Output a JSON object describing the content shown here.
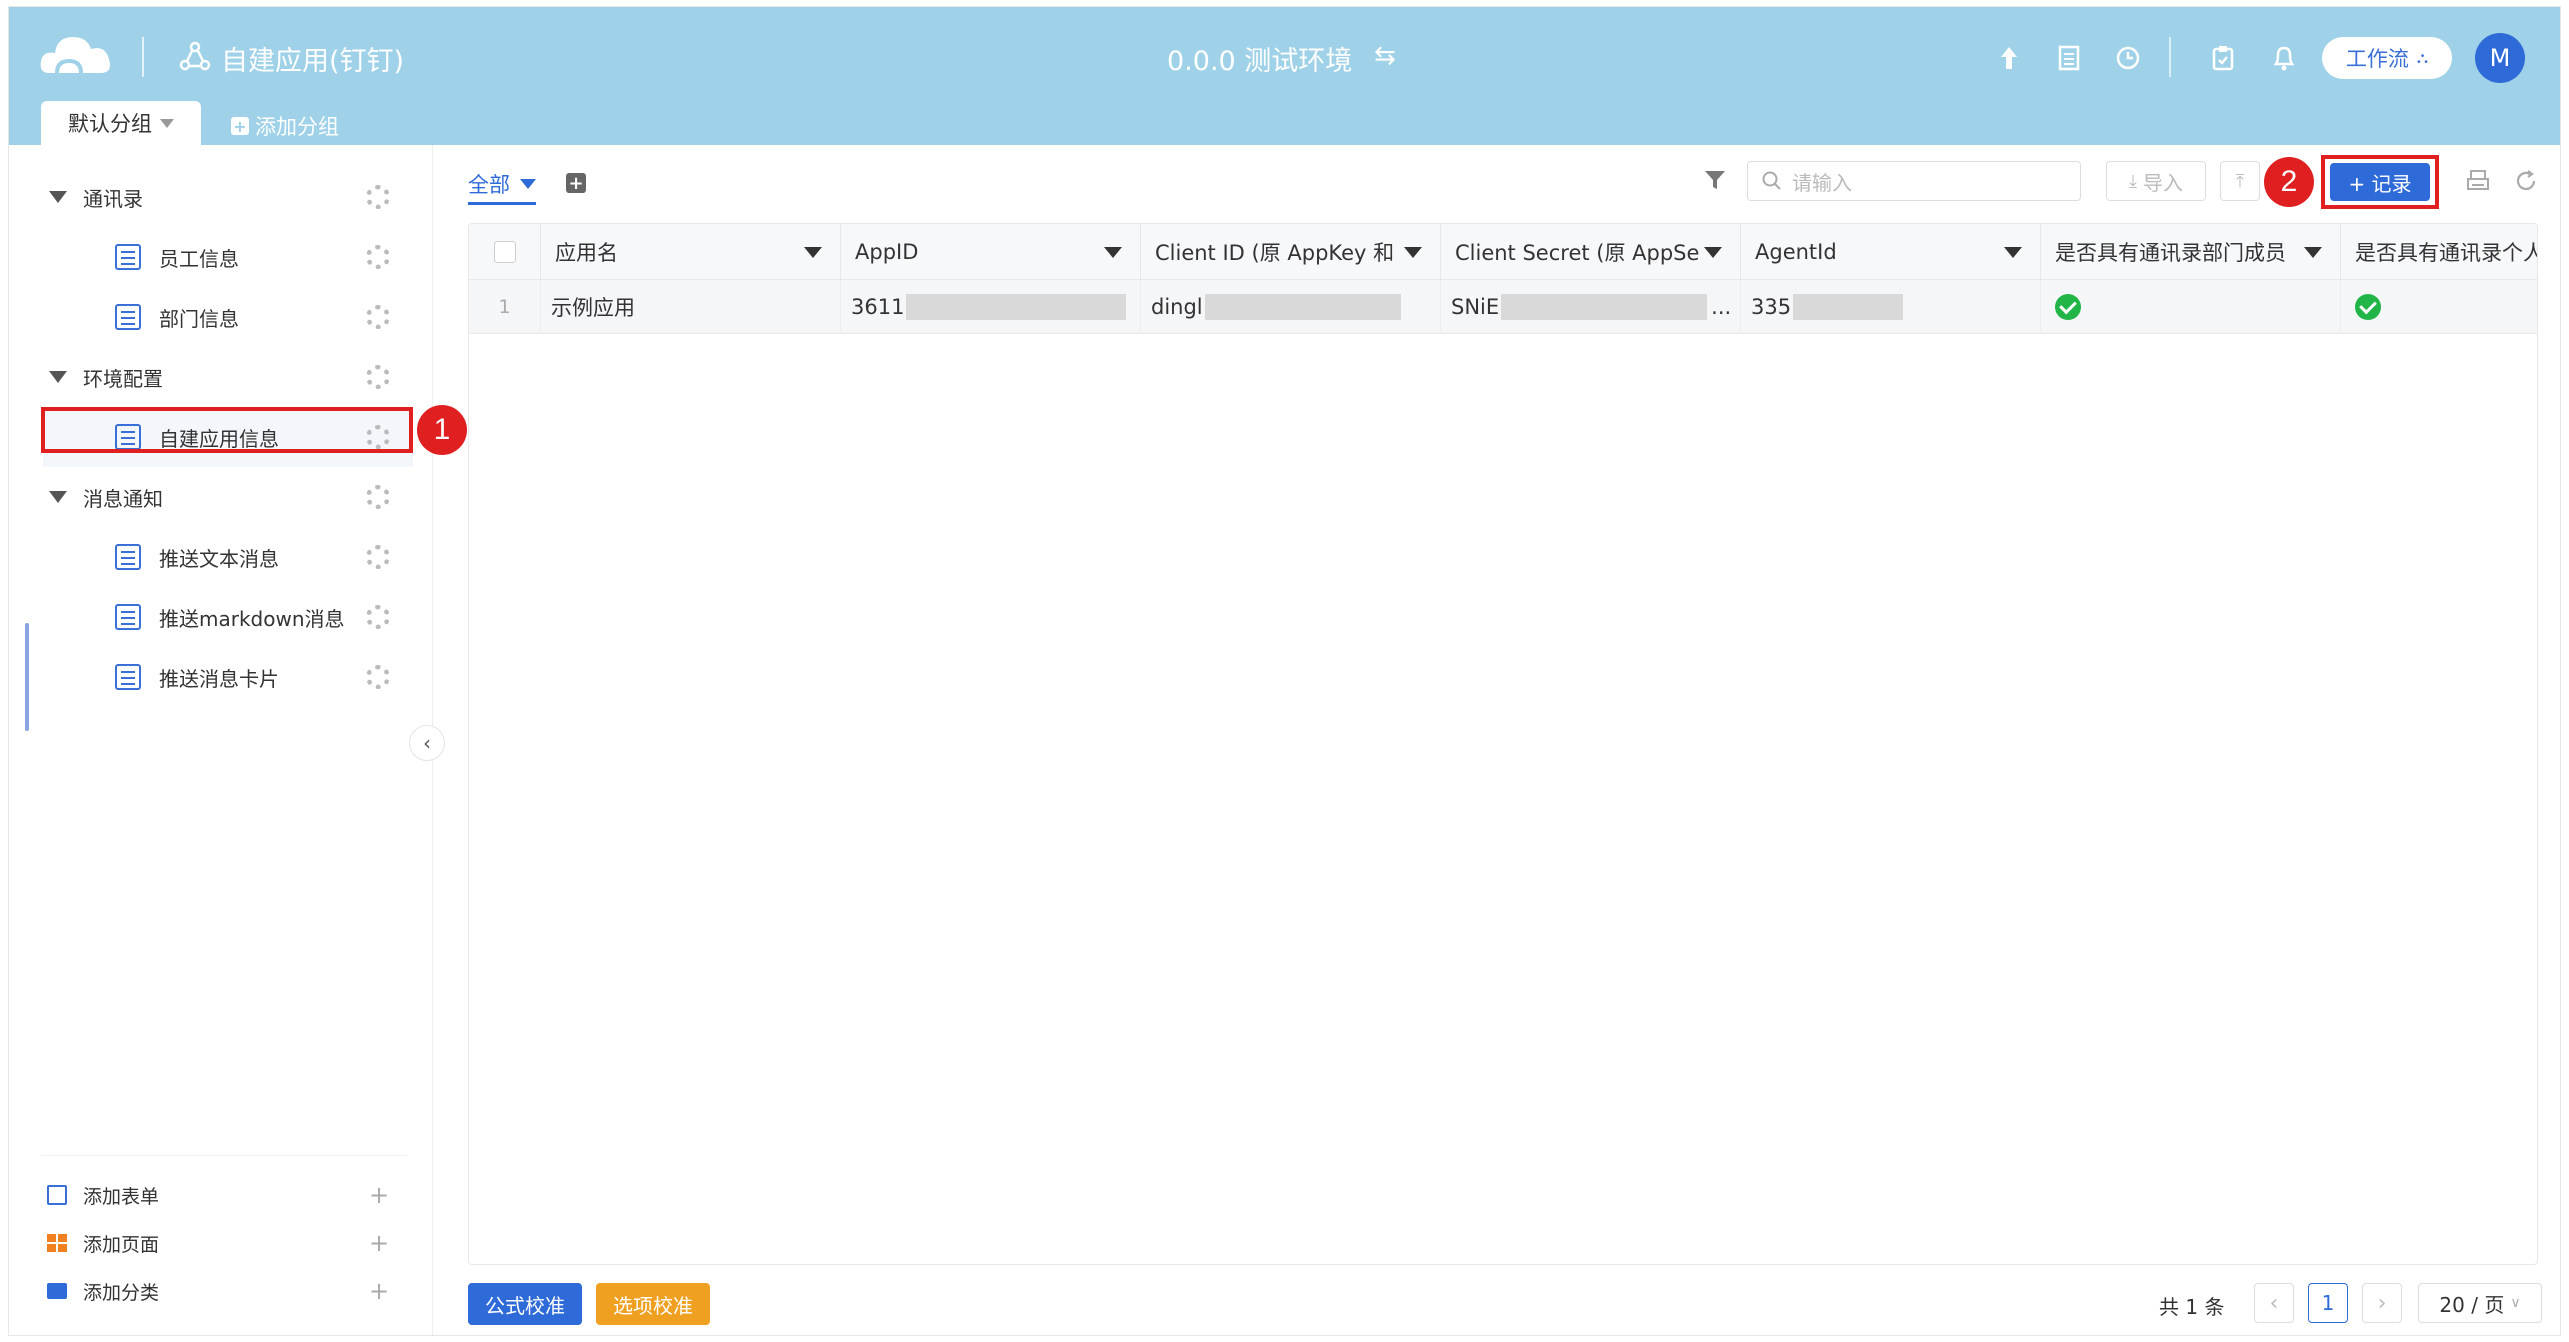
{
  "header": {
    "app_title": "自建应用(钉钉)",
    "env_title": "0.0.0 测试环境",
    "workflow_label": "工作流",
    "avatar_letter": "M",
    "tabs": [
      {
        "label": "默认分组"
      },
      {
        "label": "添加分组"
      }
    ]
  },
  "sidebar": {
    "groups": [
      {
        "label": "通讯录",
        "items": [
          "员工信息",
          "部门信息"
        ]
      },
      {
        "label": "环境配置",
        "items": [
          "自建应用信息"
        ]
      },
      {
        "label": "消息通知",
        "items": [
          "推送文本消息",
          "推送markdown消息",
          "推送消息卡片"
        ]
      }
    ],
    "footer": [
      {
        "label": "添加表单",
        "icon": "form-icon"
      },
      {
        "label": "添加页面",
        "icon": "page-icon"
      },
      {
        "label": "添加分类",
        "icon": "folder-icon"
      }
    ]
  },
  "toolbar": {
    "view_label": "全部",
    "search_placeholder": "请输入",
    "import_label": "导入",
    "add_record_label": "+ 记录"
  },
  "table": {
    "columns": [
      "应用名",
      "AppID",
      "Client ID (原 AppKey 和",
      "Client Secret (原 AppSe",
      "AgentId",
      "是否具有通讯录部门成员",
      "是否具有通讯录个人"
    ],
    "rows": [
      {
        "index": "1",
        "app_name": "示例应用",
        "app_id": "3611",
        "client_id": "dingl",
        "client_secret": "SNiE",
        "client_secret_tail": "...",
        "agent_id": "335"
      }
    ]
  },
  "bottom": {
    "formula_label": "公式校准",
    "option_label": "选项校准",
    "total_label": "共 1 条",
    "current_page": "1",
    "page_size_label": "20 / 页"
  },
  "annotations": {
    "step1": "1",
    "step2": "2"
  },
  "colors": {
    "header_bg": "#9fd2e8",
    "primary": "#3a6fd8",
    "orange": "#f0a020",
    "annotation_red": "#e02020",
    "check_green": "#21b548"
  }
}
